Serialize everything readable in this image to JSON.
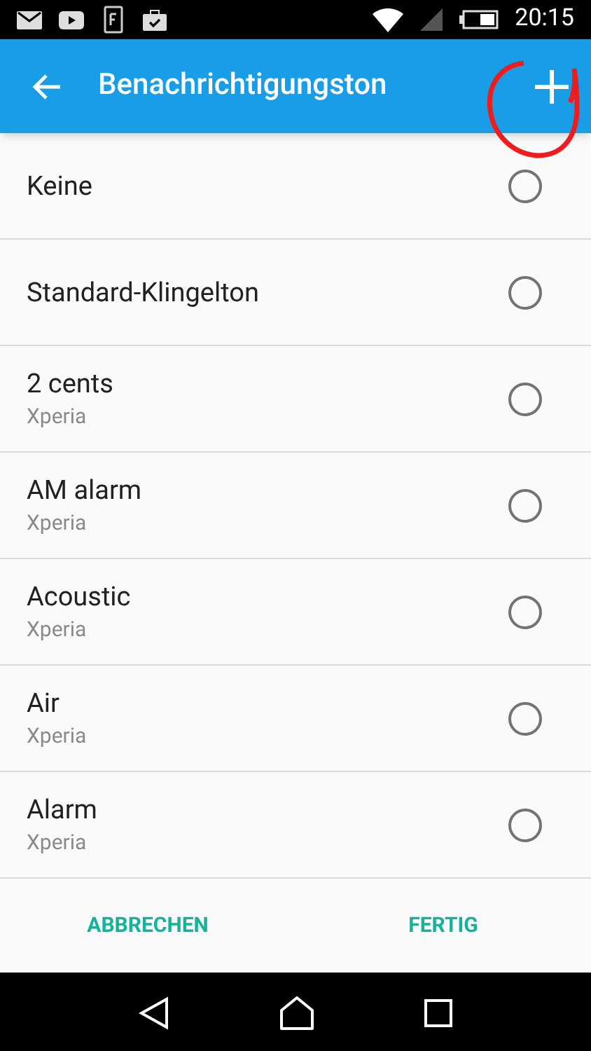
{
  "status_bar": {
    "time": "20:15"
  },
  "app_bar": {
    "title": "Benachrichtigungston"
  },
  "items": [
    {
      "title": "Keine",
      "selected": false
    },
    {
      "title": "Standard-Klingelton",
      "selected": false
    },
    {
      "title": "2 cents",
      "subtitle": "Xperia",
      "selected": false
    },
    {
      "title": "AM alarm",
      "subtitle": "Xperia",
      "selected": false
    },
    {
      "title": "Acoustic",
      "subtitle": "Xperia",
      "selected": false
    },
    {
      "title": "Air",
      "subtitle": "Xperia",
      "selected": false
    },
    {
      "title": "Alarm",
      "subtitle": "Xperia",
      "selected": false
    }
  ],
  "buttons": [
    "ABBRECHEN",
    "FERTIG"
  ]
}
